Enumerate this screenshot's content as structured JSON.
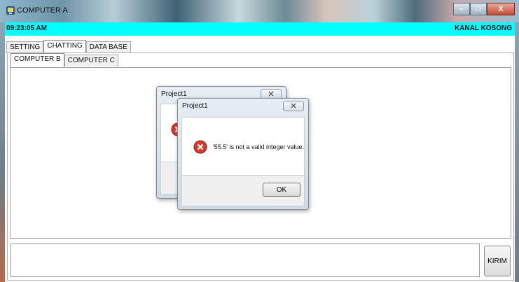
{
  "window": {
    "title": "COMPUTER A",
    "controls": [
      "minimize-icon",
      "maximize-icon",
      "close-icon"
    ]
  },
  "status": {
    "time": "09:23:05 AM",
    "channel": "KANAL KOSONG"
  },
  "main_tabs": [
    {
      "label": "SETTING",
      "active": false
    },
    {
      "label": "CHATTING",
      "active": true
    },
    {
      "label": "DATA BASE",
      "active": false
    }
  ],
  "chat_tabs": [
    {
      "label": "COMPUTER B",
      "active": true
    },
    {
      "label": "COMPUTER C",
      "active": false
    }
  ],
  "send_button": "KIRIM",
  "dialog_back": {
    "title": "Project1"
  },
  "dialog_front": {
    "title": "Project1",
    "message": "'55.5' is not a valid integer value.",
    "ok_label": "OK"
  },
  "colors": {
    "status_bar": "#00ffff",
    "error_icon": "#d63a2f"
  }
}
